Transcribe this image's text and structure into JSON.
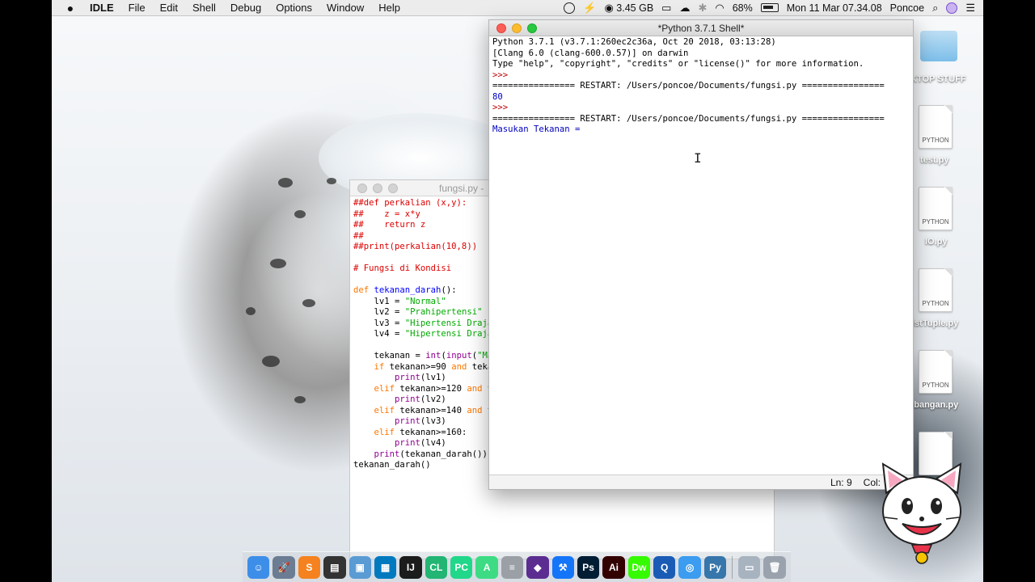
{
  "menubar": {
    "app_name": "IDLE",
    "menus": [
      "File",
      "Edit",
      "Shell",
      "Debug",
      "Options",
      "Window",
      "Help"
    ],
    "memory": "3.45 GB",
    "battery": "68%",
    "datetime": "Mon 11 Mar  07.34.08",
    "user": "Poncoe"
  },
  "shell": {
    "title": "*Python 3.7.1 Shell*",
    "lines": {
      "l1": "Python 3.7.1 (v3.7.1:260ec2c36a, Oct 20 2018, 03:13:28)",
      "l2": "[Clang 6.0 (clang-600.0.57)] on darwin",
      "l3": "Type \"help\", \"copyright\", \"credits\" or \"license()\" for more information.",
      "l4": ">>> ",
      "l5": "================ RESTART: /Users/poncoe/Documents/fungsi.py ================",
      "l6": "80",
      "l7": ">>> ",
      "l8": "================ RESTART: /Users/poncoe/Documents/fungsi.py ================",
      "l9": "Masukan Tekanan = "
    },
    "status_line": "Ln: 9",
    "status_col": "Col:"
  },
  "editor": {
    "title": "fungsi.py -",
    "code": {
      "c1": "##def perkalian (x,y):",
      "c2": "##    z = x*y",
      "c3": "##    return z",
      "c4": "##",
      "c5": "##print(perkalian(10,8))",
      "c6": "# Fungsi di Kondisi",
      "c7_kw": "def ",
      "c7_name": "tekanan_darah",
      "c7_rest": "():",
      "c8_a": "    lv1 = ",
      "c8_s": "\"Normal\"",
      "c9_a": "    lv2 = ",
      "c9_s": "\"Prahipertensi\"",
      "c10_a": "    lv3 = ",
      "c10_s": "\"Hipertensi Draja",
      "c11_a": "    lv4 = ",
      "c11_s": "\"Hipertensi Draja",
      "c12_a": "    tekanan = ",
      "c12_b1": "int",
      "c12_p": "(",
      "c12_b2": "input",
      "c12_p2": "(",
      "c12_s": "\"Ma",
      "c13_kw": "    if ",
      "c13_a": "tekanan>=90 ",
      "c13_kw2": "and",
      "c13_b": " teka",
      "c14_a": "        ",
      "c14_b": "print",
      "c14_c": "(lv1)",
      "c15_kw": "    elif ",
      "c15_a": "tekanan>=120 ",
      "c15_kw2": "and",
      "c15_b": " t",
      "c16_b": "print",
      "c16_c": "(lv2)",
      "c17_kw": "    elif ",
      "c17_a": "tekanan>=140 ",
      "c17_kw2": "and",
      "c17_b": " t",
      "c18_b": "print",
      "c18_c": "(lv3)",
      "c19_kw": "    elif ",
      "c19_a": "tekanan>=160:",
      "c20_b": "print",
      "c20_c": "(lv4)",
      "c21_a": "    ",
      "c21_b": "print",
      "c21_c": "(tekanan_darah())",
      "c22": "tekanan_darah()"
    }
  },
  "desktop": {
    "folder_label": "KTOP STUFF",
    "files": [
      {
        "type": "PYTHON",
        "label": "test.py"
      },
      {
        "type": "PYTHON",
        "label": "IO.py"
      },
      {
        "type": "PYTHON",
        "label": "istTuple.py"
      },
      {
        "type": "PYTHON",
        "label": "cabangan.py"
      }
    ]
  },
  "dock": {
    "items": [
      {
        "name": "finder",
        "glyph": "☺",
        "color": "#3d8ee8"
      },
      {
        "name": "launchpad",
        "glyph": "🚀",
        "color": "#6b7c93"
      },
      {
        "name": "sublime",
        "glyph": "S",
        "color": "#f5821f"
      },
      {
        "name": "claquette",
        "glyph": "▤",
        "color": "#333333"
      },
      {
        "name": "virtualbox",
        "glyph": "▣",
        "color": "#5a9bd4"
      },
      {
        "name": "trello",
        "glyph": "▦",
        "color": "#0079bf"
      },
      {
        "name": "intellij",
        "glyph": "IJ",
        "color": "#1c1c1c"
      },
      {
        "name": "clion",
        "glyph": "CL",
        "color": "#22b573"
      },
      {
        "name": "pycharm",
        "glyph": "PC",
        "color": "#21d789"
      },
      {
        "name": "android-studio",
        "glyph": "A",
        "color": "#3ddc84"
      },
      {
        "name": "sequel",
        "glyph": "≡",
        "color": "#9aa0a6"
      },
      {
        "name": "visual-studio",
        "glyph": "◆",
        "color": "#5c2d91"
      },
      {
        "name": "xcode",
        "glyph": "⚒",
        "color": "#1575f9"
      },
      {
        "name": "photoshop",
        "glyph": "Ps",
        "color": "#001d34"
      },
      {
        "name": "illustrator",
        "glyph": "Ai",
        "color": "#330000"
      },
      {
        "name": "dreamweaver",
        "glyph": "Dw",
        "color": "#35fa00"
      },
      {
        "name": "quicktime",
        "glyph": "Q",
        "color": "#1a5bb5"
      },
      {
        "name": "safari",
        "glyph": "◎",
        "color": "#3b9cf0"
      },
      {
        "name": "python",
        "glyph": "Py",
        "color": "#3776ab"
      },
      {
        "name": "documents",
        "glyph": "▭",
        "color": "#a8b3c0"
      },
      {
        "name": "trash",
        "glyph": "🗑",
        "color": "#9aa3ad"
      }
    ]
  },
  "colors": {
    "keyword": "#ff7700",
    "comment": "#dd0000",
    "string": "#00aa00",
    "builtin": "#900090",
    "defname": "#0000ff",
    "shell_output": "#0000c0",
    "prompt": "#c00000"
  }
}
